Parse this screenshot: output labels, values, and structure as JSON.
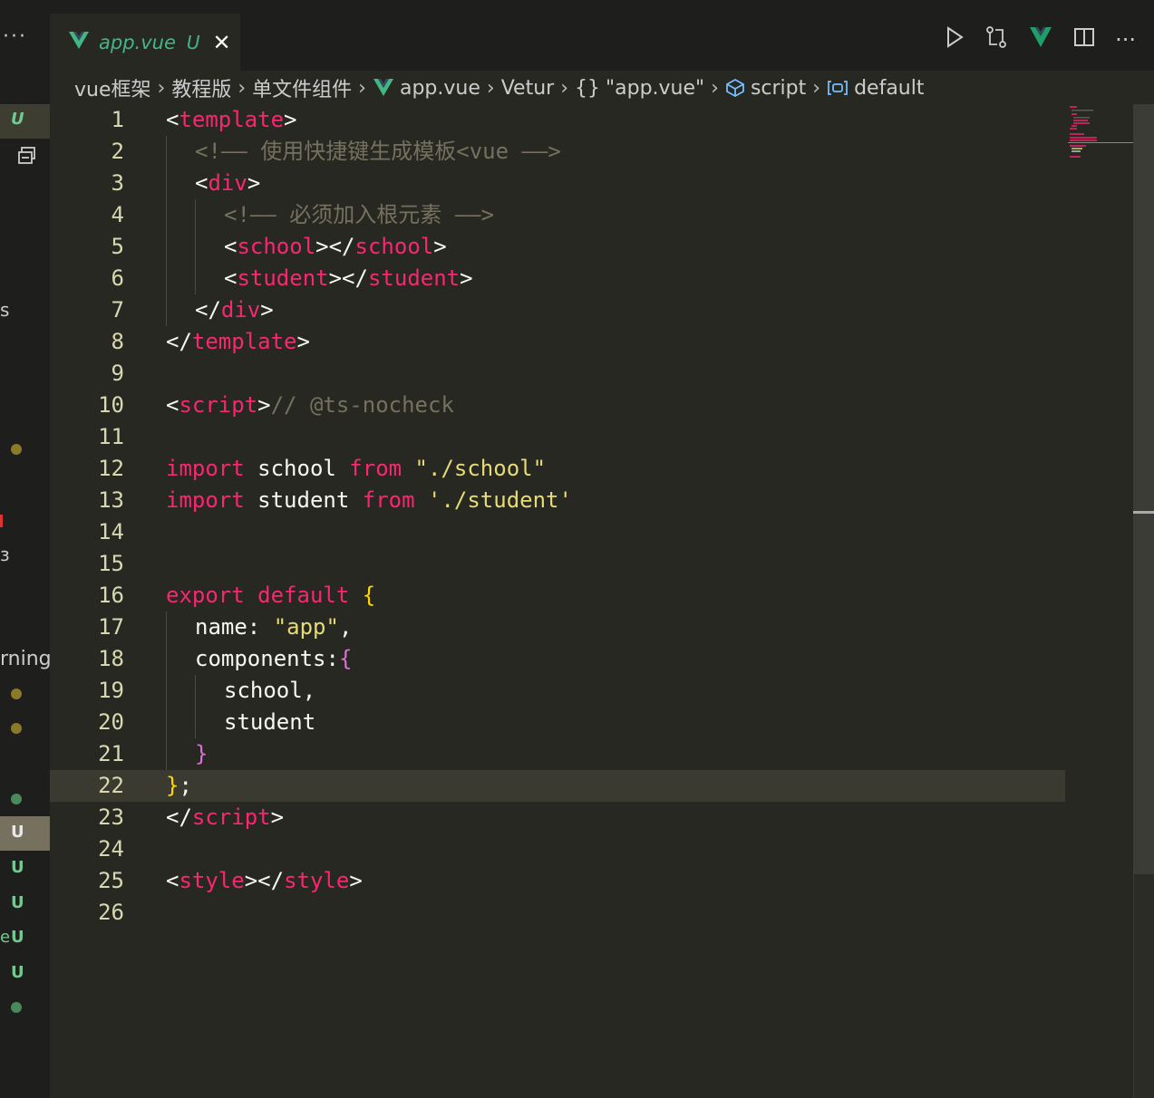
{
  "window": {
    "more_label": "···"
  },
  "tab": {
    "filename": "app.vue",
    "status": "U",
    "close": "✕"
  },
  "actions": {
    "run": "▷",
    "compare": "⇄",
    "vetur": "◆",
    "split": "◫",
    "more": "···"
  },
  "breadcrumb": [
    "vue框架",
    "教程版",
    "单文件组件",
    "app.vue",
    "Vetur",
    "\"app.vue\"",
    "script",
    "default"
  ],
  "breadcrumb_braces": "{}",
  "left_strip": {
    "u1": "U",
    "s_fragment": "s",
    "warning_fragment": "rning",
    "u2": "U",
    "u3": "U",
    "u4": "U",
    "u5": "U",
    "e_fragment": "e",
    "u6": "U"
  },
  "editor": {
    "active_line": 22,
    "lines": [
      {
        "n": "1"
      },
      {
        "n": "2"
      },
      {
        "n": "3"
      },
      {
        "n": "4"
      },
      {
        "n": "5"
      },
      {
        "n": "6"
      },
      {
        "n": "7"
      },
      {
        "n": "8"
      },
      {
        "n": "9"
      },
      {
        "n": "10"
      },
      {
        "n": "11"
      },
      {
        "n": "12"
      },
      {
        "n": "13"
      },
      {
        "n": "14"
      },
      {
        "n": "15"
      },
      {
        "n": "16"
      },
      {
        "n": "17"
      },
      {
        "n": "18"
      },
      {
        "n": "19"
      },
      {
        "n": "20"
      },
      {
        "n": "21"
      },
      {
        "n": "22"
      },
      {
        "n": "23"
      },
      {
        "n": "24"
      },
      {
        "n": "25"
      },
      {
        "n": "26"
      }
    ],
    "tokens": {
      "l1": [
        [
          "p",
          "<"
        ],
        [
          "t",
          "template"
        ],
        [
          "p",
          ">"
        ]
      ],
      "l2": [
        [
          "c",
          "<!—— 使用快捷键生成模板<vue ——>"
        ]
      ],
      "l3": [
        [
          "p",
          "<"
        ],
        [
          "t",
          "div"
        ],
        [
          "p",
          ">"
        ]
      ],
      "l4": [
        [
          "c",
          "<!—— 必须加入根元素 ——>"
        ]
      ],
      "l5": [
        [
          "p",
          "<"
        ],
        [
          "t",
          "school"
        ],
        [
          "p",
          "></"
        ],
        [
          "t",
          "school"
        ],
        [
          "p",
          ">"
        ]
      ],
      "l6": [
        [
          "p",
          "<"
        ],
        [
          "t",
          "student"
        ],
        [
          "p",
          "></"
        ],
        [
          "t",
          "student"
        ],
        [
          "p",
          ">"
        ]
      ],
      "l7": [
        [
          "p",
          "</"
        ],
        [
          "t",
          "div"
        ],
        [
          "p",
          ">"
        ]
      ],
      "l8": [
        [
          "p",
          "</"
        ],
        [
          "t",
          "template"
        ],
        [
          "p",
          ">"
        ]
      ],
      "l10": [
        [
          "p",
          "<"
        ],
        [
          "t",
          "script"
        ],
        [
          "p",
          ">"
        ],
        [
          "c",
          "// @ts-nocheck"
        ]
      ],
      "l12": [
        [
          "k",
          "import"
        ],
        [
          "p",
          " school "
        ],
        [
          "k",
          "from"
        ],
        [
          "p",
          " "
        ],
        [
          "s",
          "\"./school\""
        ]
      ],
      "l13": [
        [
          "k",
          "import"
        ],
        [
          "p",
          " student "
        ],
        [
          "k",
          "from"
        ],
        [
          "p",
          " "
        ],
        [
          "s",
          "'./student'"
        ]
      ],
      "l16": [
        [
          "k",
          "export"
        ],
        [
          "p",
          " "
        ],
        [
          "k",
          "default"
        ],
        [
          "p",
          " "
        ],
        [
          "b1",
          "{"
        ]
      ],
      "l17": [
        [
          "p",
          "name: "
        ],
        [
          "s",
          "\"app\""
        ],
        [
          "p",
          ","
        ]
      ],
      "l18": [
        [
          "p",
          "components:"
        ],
        [
          "b2",
          "{"
        ]
      ],
      "l19": [
        [
          "p",
          "school,"
        ]
      ],
      "l20": [
        [
          "p",
          "student"
        ]
      ],
      "l21": [
        [
          "b2",
          "}"
        ]
      ],
      "l22": [
        [
          "b1",
          "}"
        ],
        [
          "p",
          ";"
        ]
      ],
      "l23": [
        [
          "p",
          "</"
        ],
        [
          "t",
          "script"
        ],
        [
          "p",
          ">"
        ]
      ],
      "l25": [
        [
          "p",
          "<"
        ],
        [
          "t",
          "style"
        ],
        [
          "p",
          "></"
        ],
        [
          "t",
          "style"
        ],
        [
          "p",
          ">"
        ]
      ]
    }
  }
}
